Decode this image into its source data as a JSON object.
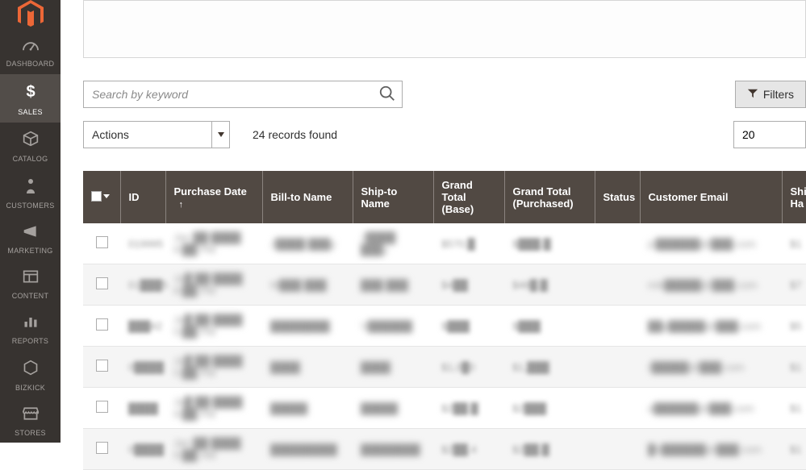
{
  "sidebar": {
    "items": [
      {
        "label": "DASHBOARD",
        "icon": "gauge"
      },
      {
        "label": "SALES",
        "icon": "dollar",
        "active": true
      },
      {
        "label": "CATALOG",
        "icon": "cube"
      },
      {
        "label": "CUSTOMERS",
        "icon": "person"
      },
      {
        "label": "MARKETING",
        "icon": "megaphone"
      },
      {
        "label": "CONTENT",
        "icon": "layout"
      },
      {
        "label": "REPORTS",
        "icon": "bars"
      },
      {
        "label": "BIZKICK",
        "icon": "hex"
      },
      {
        "label": "STORES",
        "icon": "storefront"
      }
    ]
  },
  "search": {
    "placeholder": "Search by keyword",
    "value": ""
  },
  "filters_label": "Filters",
  "actions": {
    "label": "Actions"
  },
  "records_found": "24 records found",
  "page_size": "20",
  "columns": {
    "id": "ID",
    "purchase_date": "Purchase Date",
    "bill_to": "Bill-to Name",
    "ship_to": "Ship-to Name",
    "gtb": "Grand Total (Base)",
    "gtp": "Grand Total (Purchased)",
    "status": "Status",
    "email": "Customer Email",
    "ship_handle": "Ship Ha"
  },
  "rows": [
    {
      "id": "019995",
      "date": "Jan ██ ████\n9:██ PM",
      "bill": "J████ ███y",
      "ship": "J████ ███y",
      "gtb": "$570.█",
      "gtp": "$███.█",
      "status": "",
      "email": "jc██████@███.com",
      "sh": "$1"
    },
    {
      "id": "01███5",
      "date": "Ja█ ██ ████\n8:██ PM",
      "bill": "M███ ███",
      "ship": "███ ███",
      "gtb": "$4██",
      "gtp": "$48█.█",
      "status": "",
      "email": "mik█████@███.com",
      "sh": "$7"
    },
    {
      "id": "███42",
      "date": "Ja█ ██ ████\n5:██ PM",
      "bill": "████████",
      "ship": "V██████",
      "gtb": "$███",
      "gtp": "$███",
      "status": "",
      "email": "██y█████@███.com",
      "sh": "$5"
    },
    {
      "id": "0████",
      "date": "Ja█ ██ ████\n5:██ PM",
      "bill": "████",
      "ship": "████",
      "gtb": "$1,0█0",
      "gtp": "$1,███",
      "status": "",
      "email": "r█████@███.com",
      "sh": "$1"
    },
    {
      "id": "████",
      "date": "Ja█ ██ ████\n9:██ PM",
      "bill": "█████",
      "ship": "█████",
      "gtb": "$2██.█",
      "gtp": "$2███",
      "status": "",
      "email": "a██████@███.com",
      "sh": "$1"
    },
    {
      "id": "0████",
      "date": "Jan ██ ████\n9:██ HM",
      "bill": "█████████",
      "ship": "████████",
      "gtb": "$2██.4",
      "gtp": "$2██.█",
      "status": "",
      "email": "█b██████@███.com",
      "sh": "$1"
    }
  ]
}
